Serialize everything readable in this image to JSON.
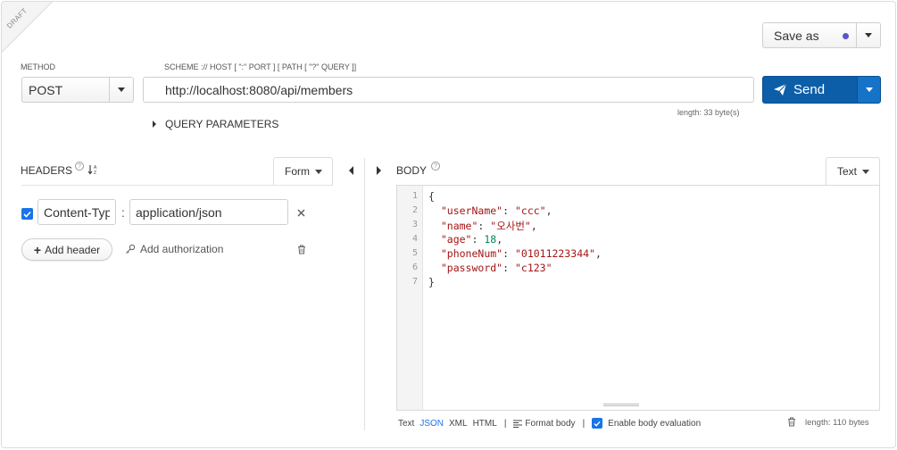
{
  "draft": {
    "label": "DRAFT"
  },
  "save": {
    "label": "Save as",
    "dot_color": "#5a55c9"
  },
  "method": {
    "label": "METHOD",
    "value": "POST"
  },
  "url": {
    "label": "SCHEME :// HOST [ \":\" PORT ] [ PATH [ \"?\" QUERY ]]",
    "value": "http://localhost:8080/api/members",
    "length": "length: 33 byte(s)"
  },
  "send": {
    "label": "Send",
    "color": "#0d5ea8"
  },
  "query_params": {
    "label": "QUERY PARAMETERS"
  },
  "headers": {
    "title": "HEADERS",
    "mode": "Form",
    "rows": [
      {
        "checked": true,
        "name": "Content-Typ",
        "value": "application/json"
      }
    ],
    "add_header": "Add header",
    "add_auth": "Add authorization"
  },
  "body": {
    "title": "BODY",
    "mode": "Text",
    "lines": [
      "1",
      "2",
      "3",
      "4",
      "5",
      "6",
      "7"
    ],
    "code": {
      "open": "{",
      "l2_key": "\"userName\"",
      "l2_val": "\"ccc\"",
      "l3_key": "\"name\"",
      "l3_val": "\"오사번\"",
      "l4_key": "\"age\"",
      "l4_val": "18",
      "l5_key": "\"phoneNum\"",
      "l5_val": "\"01011223344\"",
      "l6_key": "\"password\"",
      "l6_val": "\"c123\"",
      "close": "}"
    },
    "formats": [
      "Text",
      "JSON",
      "XML",
      "HTML"
    ],
    "active_format": "JSON",
    "format_body": "Format body",
    "enable_eval": "Enable body evaluation",
    "length": "length: 110 bytes"
  }
}
